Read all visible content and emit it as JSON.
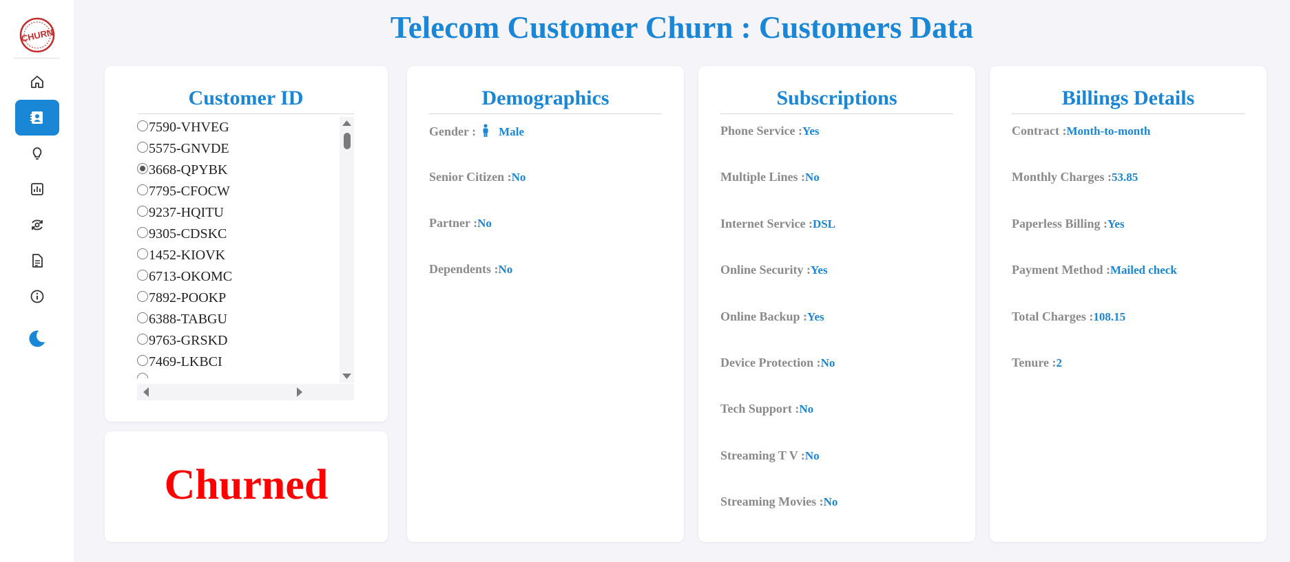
{
  "app": {
    "title": "Telecom Customer Churn : Customers Data",
    "logo_text": "CHURN"
  },
  "sidebar": {
    "items": [
      {
        "icon": "home-icon",
        "label": "Home"
      },
      {
        "icon": "contact-card-icon",
        "label": "Customers Data",
        "active": true
      },
      {
        "icon": "lightbulb-icon",
        "label": "Insights"
      },
      {
        "icon": "bar-chart-icon",
        "label": "Charts"
      },
      {
        "icon": "refresh-eye-icon",
        "label": "Prediction"
      },
      {
        "icon": "document-icon",
        "label": "Report"
      },
      {
        "icon": "info-icon",
        "label": "About"
      },
      {
        "icon": "moon-icon",
        "label": "Dark mode"
      }
    ]
  },
  "customer_id": {
    "title": "Customer ID",
    "selected": "3668-QPYBK",
    "ids": [
      "7590-VHVEG",
      "5575-GNVDE",
      "3668-QPYBK",
      "7795-CFOCW",
      "9237-HQITU",
      "9305-CDSKC",
      "1452-KIOVK",
      "6713-OKOMC",
      "7892-POOKP",
      "6388-TABGU",
      "9763-GRSKD",
      "7469-LKBCI"
    ]
  },
  "status": {
    "label": "Churned",
    "color": "#ff0000"
  },
  "demographics": {
    "title": "Demographics",
    "gender_label": "Gender : ",
    "gender": "Male",
    "senior_label": "Senior Citizen :",
    "senior": "No",
    "partner_label": "Partner :",
    "partner": "No",
    "dependents_label": "Dependents :",
    "dependents": "No"
  },
  "subscriptions": {
    "title": "Subscriptions",
    "fields": [
      {
        "label": "Phone Service :",
        "value": "Yes"
      },
      {
        "label": "Multiple Lines :",
        "value": "No"
      },
      {
        "label": "Internet Service :",
        "value": "DSL"
      },
      {
        "label": "Online Security :",
        "value": "Yes"
      },
      {
        "label": "Online Backup :",
        "value": "Yes"
      },
      {
        "label": "Device Protection :",
        "value": "No"
      },
      {
        "label": "Tech Support :",
        "value": "No"
      },
      {
        "label": "Streaming T V :",
        "value": "No"
      },
      {
        "label": "Streaming Movies :",
        "value": "No"
      }
    ]
  },
  "billing": {
    "title": "Billings Details",
    "fields": [
      {
        "label": "Contract :",
        "value": "Month-to-month"
      },
      {
        "label": "Monthly Charges :",
        "value": "53.85"
      },
      {
        "label": "Paperless Billing :",
        "value": "Yes"
      },
      {
        "label": "Payment Method :",
        "value": "Mailed check"
      },
      {
        "label": "Total Charges :",
        "value": "108.15"
      },
      {
        "label": "Tenure :",
        "value": "2"
      }
    ]
  },
  "colors": {
    "accent": "#1a86d6",
    "label": "#8a8a8a",
    "churned": "#ff0000",
    "background": "#f4f4f9"
  }
}
